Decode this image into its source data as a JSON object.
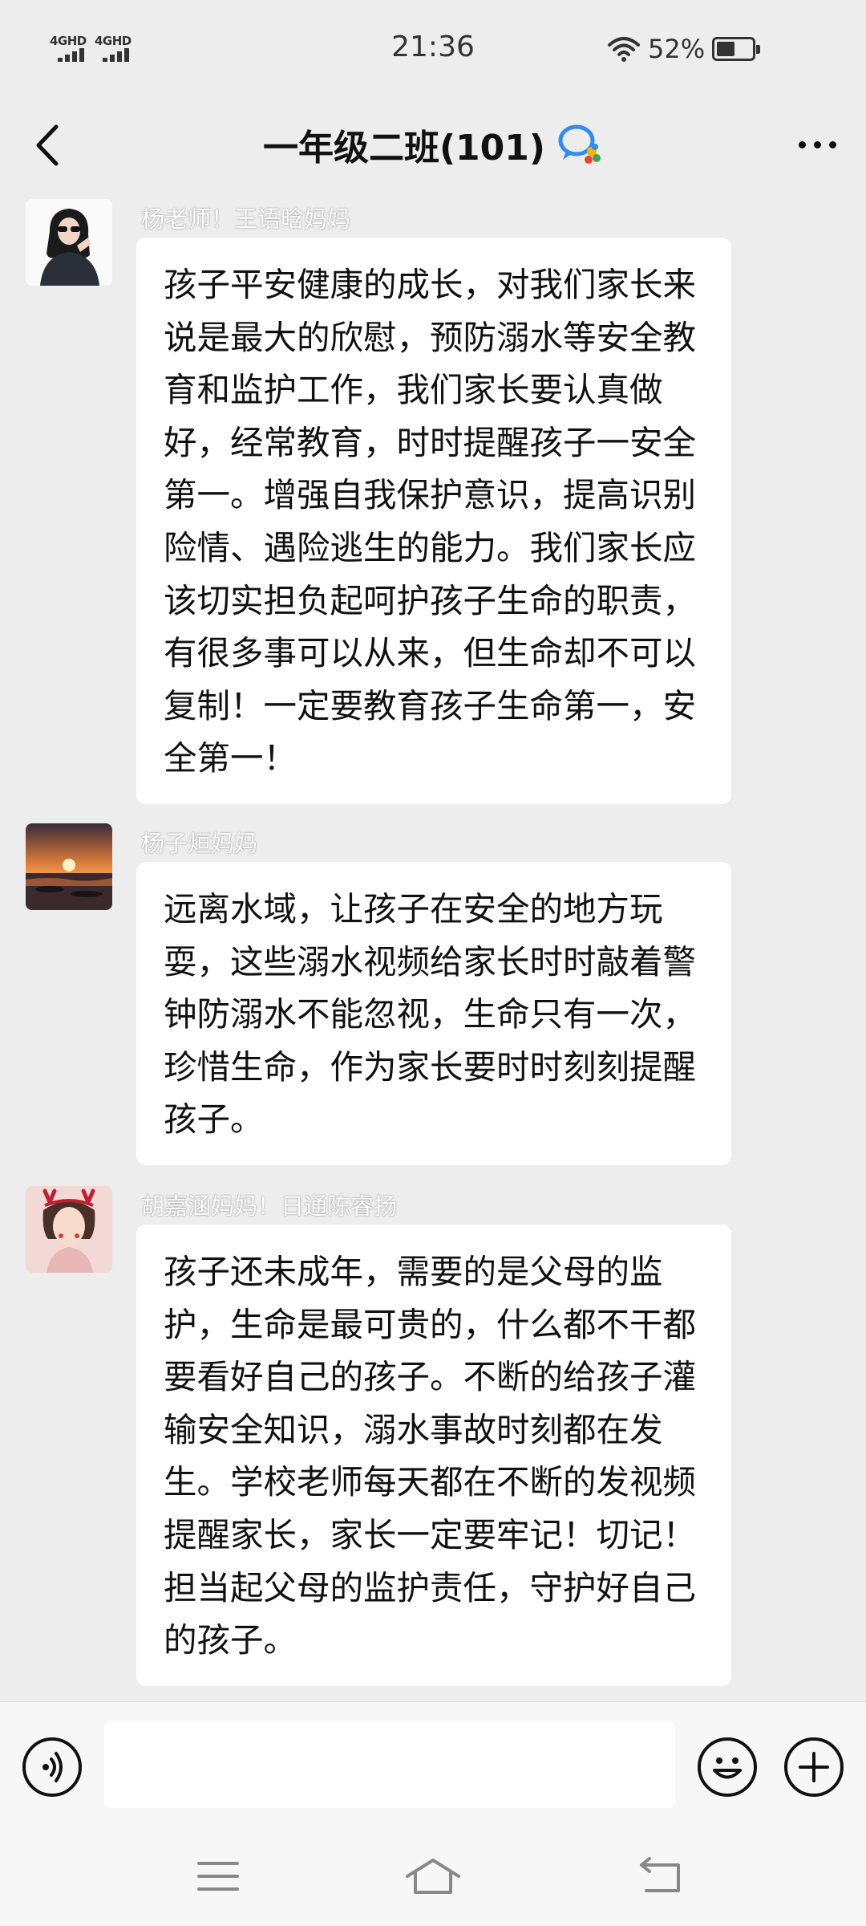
{
  "status_bar": {
    "network1": "4GHD",
    "network2": "4GHD",
    "time": "21:36",
    "battery": "52%"
  },
  "header": {
    "title": "一年级二班(101)"
  },
  "messages": [
    {
      "sender": "杨老师！王语晗妈妈",
      "text": "孩子平安健康的成长，对我们家长来说是最大的欣慰，预防溺水等安全教育和监护工作，我们家长要认真做好，经常教育，时时提醒孩子一安全第一。增强自我保护意识，提高识别险情、遇险逃生的能力。我们家长应该切实担负起呵护孩子生命的职责，有很多事可以从来，但生命却不可以复制！一定要教育孩子生命第一，安全第一！"
    },
    {
      "sender": "杨子烜妈妈",
      "text": "远离水域，让孩子在安全的地方玩耍，这些溺水视频给家长时时敲着警钟防溺水不能忽视，生命只有一次，珍惜生命，作为家长要时时刻刻提醒孩子。"
    },
    {
      "sender": "胡嘉涵妈妈！日通陈睿扬",
      "text": "孩子还未成年，需要的是父母的监护，生命是最可贵的，什么都不干都要看好自己的孩子。不断的给孩子灌输安全知识，溺水事故时刻都在发生。学校老师每天都在不断的发视频提醒家长，家长一定要牢记！切记！担当起父母的监护责任，守护好自己的孩子。"
    }
  ],
  "input": {
    "value": ""
  },
  "icons": {
    "back": "chevron-left-icon",
    "group": "group-chat-icon",
    "more": "more-dots-icon",
    "voice": "voice-icon",
    "emoji": "emoji-icon",
    "plus": "plus-icon",
    "menu": "menu-icon",
    "home": "home-icon",
    "return": "back-arrow-icon"
  }
}
